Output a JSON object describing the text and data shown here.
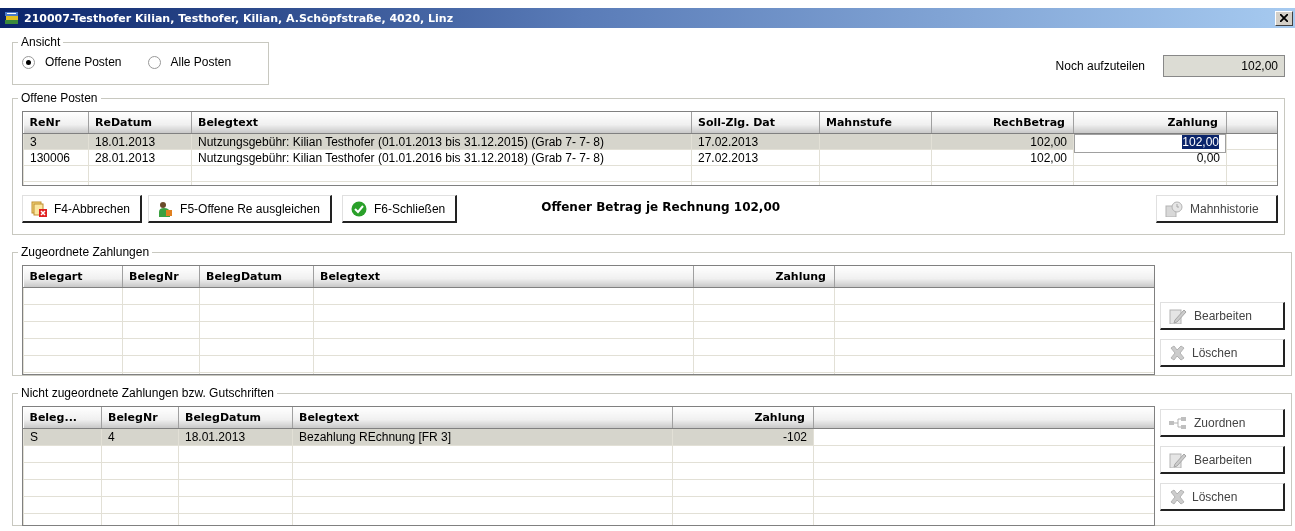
{
  "window": {
    "title": "210007-Testhofer Kilian, Testhofer, Kilian, A.Schöpfstraße, 4020, Linz"
  },
  "view": {
    "legend": "Ansicht",
    "options": [
      {
        "label": "Offene Posten",
        "selected": true
      },
      {
        "label": "Alle Posten",
        "selected": false
      }
    ]
  },
  "remaining": {
    "label": "Noch aufzuteilen",
    "value": "102,00"
  },
  "open_items": {
    "legend": "Offene Posten",
    "table": {
      "columns": [
        "ReNr",
        "ReDatum",
        "Belegtext",
        "Soll-Zlg. Dat",
        "Mahnstufe",
        "RechBetrag",
        "Zahlung"
      ],
      "rows": [
        {
          "selected": true,
          "editing": true,
          "cells": [
            "3",
            "18.01.2013",
            "Nutzungsgebühr: Kilian Testhofer (01.01.2013 bis 31.12.2015) (Grab  7- 7-  8)",
            "17.02.2013",
            "",
            "102,00",
            "102,00"
          ]
        },
        {
          "selected": false,
          "editing": false,
          "cells": [
            "130006",
            "28.01.2013",
            "Nutzungsgebühr: Kilian Testhofer (01.01.2016 bis 31.12.2018) (Grab  7- 7-  8)",
            "27.02.2013",
            "",
            "102,00",
            "0,00"
          ]
        }
      ]
    },
    "buttons": [
      {
        "label": "F4-Abbrechen",
        "kind": "cancel",
        "disabled": false
      },
      {
        "label": "F5-Offene Re ausgleichen",
        "kind": "balance",
        "disabled": false
      },
      {
        "label": "F6-Schließen",
        "kind": "close",
        "disabled": false
      }
    ],
    "summary": "Offener Betrag je Rechnung 102,00",
    "history_button": {
      "label": "Mahnhistorie",
      "kind": "history",
      "disabled": true
    }
  },
  "assigned": {
    "legend": "Zugeordnete Zahlungen",
    "table": {
      "columns": [
        "Belegart",
        "BelegNr",
        "BelegDatum",
        "Belegtext",
        "Zahlung"
      ]
    },
    "buttons": [
      {
        "label": "Bearbeiten",
        "kind": "edit",
        "disabled": true
      },
      {
        "label": "Löschen",
        "kind": "delete",
        "disabled": true
      }
    ]
  },
  "unassigned": {
    "legend": "Nicht zugeordnete Zahlungen bzw. Gutschriften",
    "table": {
      "columns": [
        "Beleg...",
        "BelegNr",
        "BelegDatum",
        "Belegtext",
        "Zahlung"
      ],
      "rows": [
        {
          "selected": true,
          "cells": [
            "S",
            "4",
            "18.01.2013",
            "Bezahlung REchnung [FR 3]",
            "-102"
          ]
        }
      ]
    },
    "buttons": [
      {
        "label": "Zuordnen",
        "kind": "assign",
        "disabled": true
      },
      {
        "label": "Bearbeiten",
        "kind": "edit",
        "disabled": true
      },
      {
        "label": "Löschen",
        "kind": "delete",
        "disabled": true
      }
    ]
  }
}
